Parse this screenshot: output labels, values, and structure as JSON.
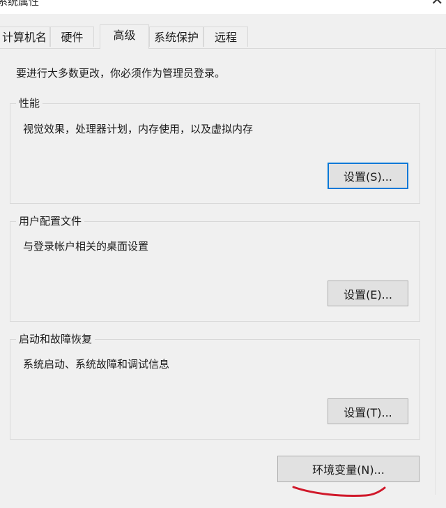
{
  "window": {
    "title": "系统属性",
    "close_glyph": "✕"
  },
  "tabs": [
    {
      "label": "计算机名"
    },
    {
      "label": "硬件"
    },
    {
      "label": "高级"
    },
    {
      "label": "系统保护"
    },
    {
      "label": "远程"
    }
  ],
  "intro_text": "要进行大多数更改，你必须作为管理员登录。",
  "groups": {
    "performance": {
      "title": "性能",
      "description": "视觉效果，处理器计划，内存使用，以及虚拟内存",
      "button_label": "设置(S)..."
    },
    "user_profiles": {
      "title": "用户配置文件",
      "description": "与登录帐户相关的桌面设置",
      "button_label": "设置(E)..."
    },
    "startup_recovery": {
      "title": "启动和故障恢复",
      "description": "系统启动、系统故障和调试信息",
      "button_label": "设置(T)..."
    }
  },
  "env_button_label": "环境变量(N)...",
  "annotation_color": "#d0182a"
}
